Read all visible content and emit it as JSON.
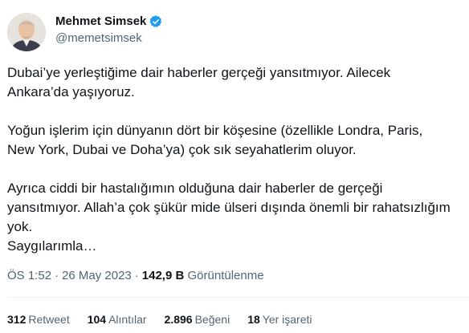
{
  "author": {
    "name": "Mehmet Simsek",
    "handle": "@memetsimsek",
    "verified_icon": "verified-badge-icon",
    "verified_color": "#1d9bf0"
  },
  "tweet": {
    "paragraphs": [
      "Dubai’ye yerleştiğime dair haberler gerçeği yansıtmıyor. Ailecek\nAnkara’da yaşıyoruz.",
      "Yoğun işlerim için dünyanın dört bir köşesine (özellikle Londra, Paris,\nNew York, Dubai ve Doha’ya) çok sık seyahatlerim oluyor.",
      "Ayrıca ciddi bir hastalığımın olduğuna dair haberler de gerçeği\nyansıtmıyor. Allah’a çok şükür mide ülseri dışında önemli bir rahatsızlığım\nyok.\nSaygılarımla…"
    ]
  },
  "meta": {
    "time": "ÖS 1:52",
    "separator": "·",
    "date": "26 May 2023",
    "views_count": "142,9 B",
    "views_label": "Görüntülenme"
  },
  "stats": {
    "retweets": {
      "count": "312",
      "label": "Retweet"
    },
    "quotes": {
      "count": "104",
      "label": "Alıntılar"
    },
    "likes": {
      "count": "2.896",
      "label": "Beğeni"
    },
    "bookmarks": {
      "count": "18",
      "label": "Yer işareti"
    }
  },
  "colors": {
    "text_primary": "#0f1419",
    "text_secondary": "#536471",
    "divider": "#eff3f4"
  }
}
